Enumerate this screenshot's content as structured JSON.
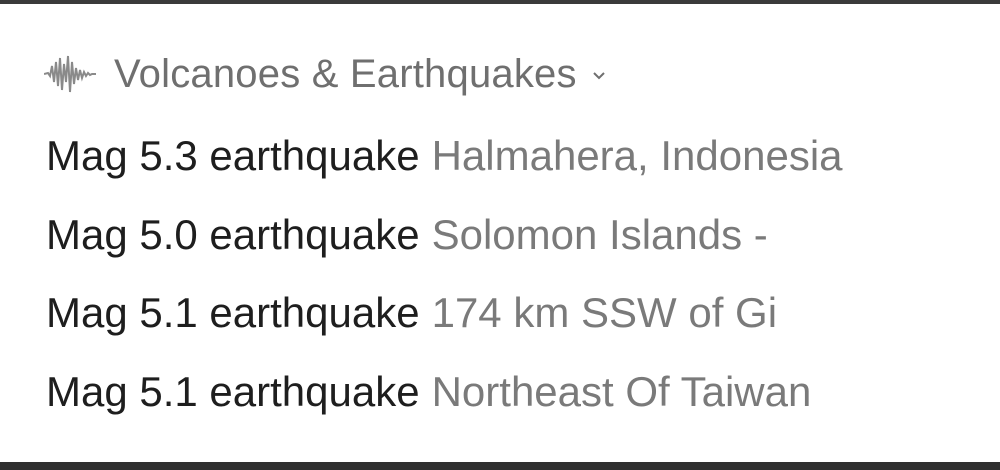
{
  "header": {
    "icon": "seismograph-icon",
    "title": "Volcanoes & Earthquakes",
    "expand_icon": "chevron-down-icon"
  },
  "items": [
    {
      "title": "Mag 5.3 earthquake",
      "location": "Halmahera, Indonesia"
    },
    {
      "title": "Mag 5.0 earthquake",
      "location": "Solomon Islands - "
    },
    {
      "title": "Mag 5.1 earthquake",
      "location": "174 km SSW of Gi"
    },
    {
      "title": "Mag 5.1 earthquake",
      "location": "Northeast Of Taiwan"
    }
  ],
  "colors": {
    "title_text": "#1e1e1e",
    "secondary_text": "#7a7a7a",
    "header_text": "#6f6f6f"
  }
}
